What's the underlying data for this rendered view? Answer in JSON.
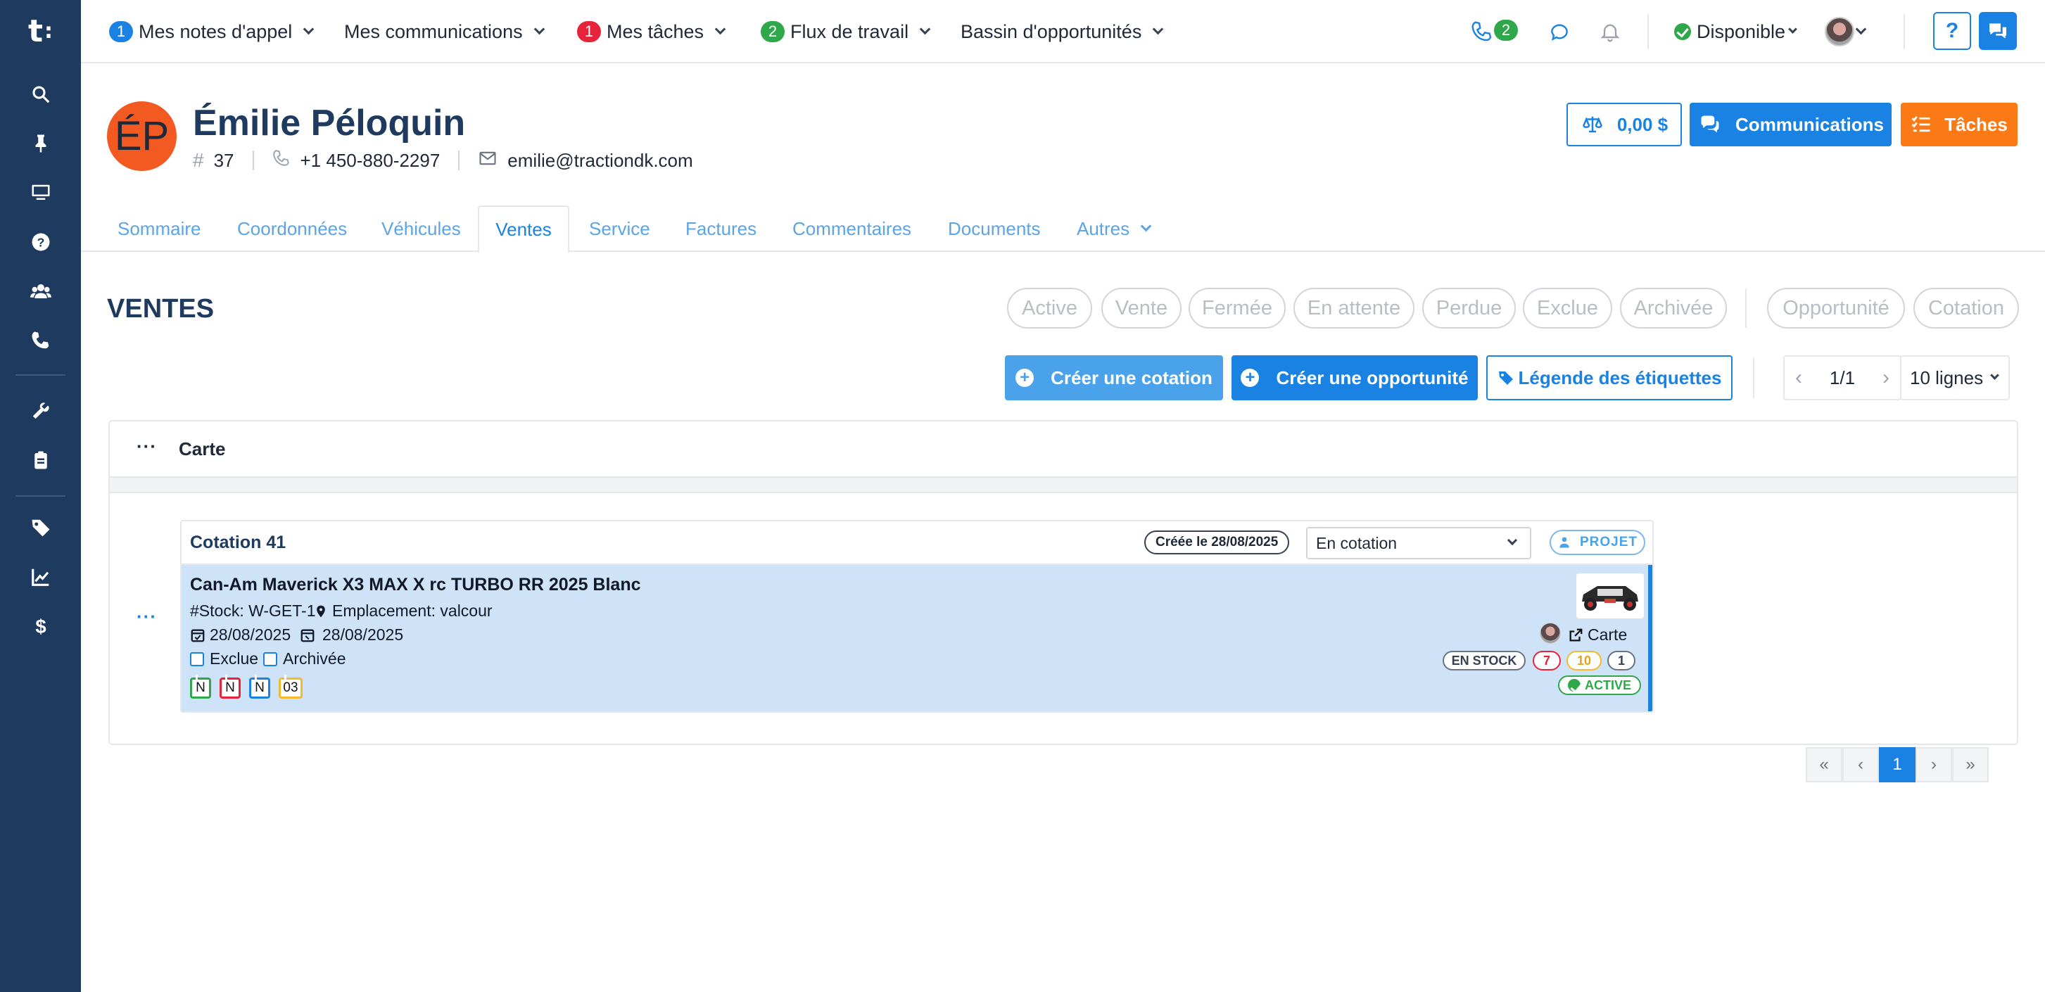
{
  "brand": {
    "logo_text": "t",
    "logo_dots": ":"
  },
  "topnav": {
    "items": [
      {
        "badge": "1",
        "label": "Mes notes d'appel"
      },
      {
        "badge": "",
        "label": "Mes communications"
      },
      {
        "badge": "1",
        "label": "Mes tâches"
      },
      {
        "badge": "2",
        "label": "Flux de travail"
      },
      {
        "badge": "",
        "label": "Bassin d'opportunités"
      }
    ],
    "phone_badge": "2",
    "status_label": "Disponible",
    "help_label": "?"
  },
  "client": {
    "initials": "ÉP",
    "name": "Émilie Péloquin",
    "number": "37",
    "phone": "+1 450-880-2297",
    "email": "emilie@tractiondk.com",
    "balance_label": "0,00 $",
    "communications_label": "Communications",
    "tasks_label": "Tâches"
  },
  "tabs": [
    {
      "label": "Sommaire"
    },
    {
      "label": "Coordonnées"
    },
    {
      "label": "Véhicules"
    },
    {
      "label": "Ventes"
    },
    {
      "label": "Service"
    },
    {
      "label": "Factures"
    },
    {
      "label": "Commentaires"
    },
    {
      "label": "Documents"
    },
    {
      "label": "Autres"
    }
  ],
  "active_tab": "Ventes",
  "section": {
    "title": "VENTES",
    "filters": [
      "Active",
      "Vente",
      "Fermée",
      "En attente",
      "Perdue",
      "Exclue",
      "Archivée"
    ],
    "type_filters": [
      "Opportunité",
      "Cotation"
    ],
    "create_quote_label": "Créer une cotation",
    "create_opportunity_label": "Créer une opportunité",
    "legend_label": "Légende des étiquettes",
    "page_label": "1/1",
    "rows_label": "10 lignes"
  },
  "panel": {
    "view_label": "Carte",
    "more_label": "···",
    "quote": {
      "title": "Cotation 41",
      "created_label": "Créée le 28/08/2025",
      "status_value": "En cotation",
      "projet_label": "PROJET",
      "vehicle": "Can-Am Maverick X3 MAX X rc TURBO RR 2025 Blanc",
      "stock": "#Stock: W-GET-1",
      "location": "Emplacement: valcour",
      "date1": "28/08/2025",
      "date2": "28/08/2025",
      "exclue_label": "Exclue",
      "archivee_label": "Archivée",
      "tags": [
        "N",
        "N",
        "N",
        "03"
      ],
      "card_link_label": "Carte",
      "stock_status": "EN STOCK",
      "counts": [
        "7",
        "10",
        "1"
      ],
      "state_label": "ACTIVE"
    }
  },
  "pagination": {
    "first": "«",
    "prev": "‹",
    "current": "1",
    "next": "›",
    "last": "»"
  },
  "colors": {
    "primary": "#1a82e2",
    "sidebar": "#1e3a5f",
    "orange": "#fb7a16",
    "avatar": "#f25a22",
    "green": "#2ea84a",
    "red": "#e5243b"
  }
}
